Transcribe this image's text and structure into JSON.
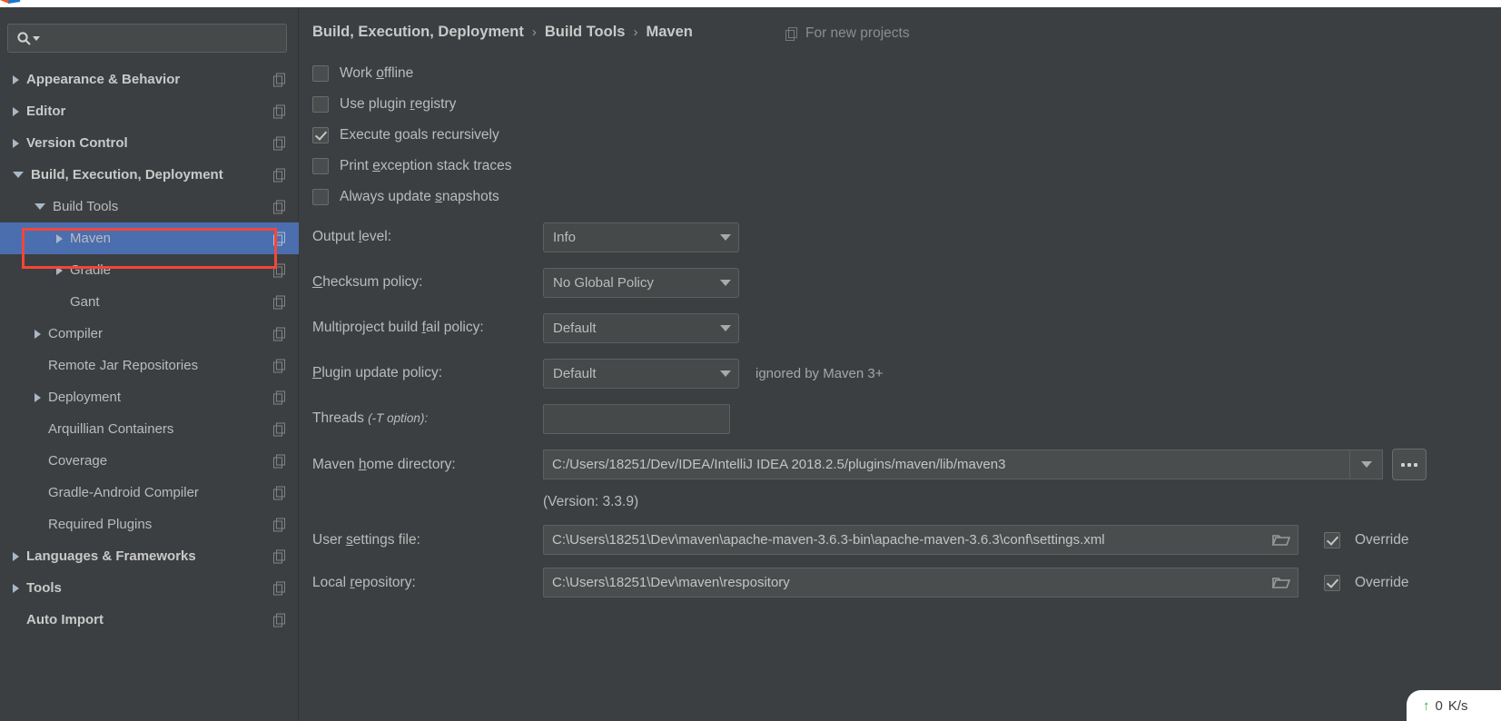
{
  "window": {
    "app_accent": "#4b6eaf",
    "highlight_outline": "#f2463a"
  },
  "sidebar": {
    "search": {
      "placeholder": "",
      "value": "",
      "icon": "search-icon"
    },
    "items": [
      {
        "label": "Appearance & Behavior",
        "indent": 0,
        "arrow": "right",
        "bold": true,
        "selected": false
      },
      {
        "label": "Editor",
        "indent": 0,
        "arrow": "right",
        "bold": true,
        "selected": false
      },
      {
        "label": "Version Control",
        "indent": 0,
        "arrow": "right",
        "bold": true,
        "selected": false
      },
      {
        "label": "Build, Execution, Deployment",
        "indent": 0,
        "arrow": "down",
        "bold": true,
        "selected": false
      },
      {
        "label": "Build Tools",
        "indent": 1,
        "arrow": "down",
        "bold": false,
        "selected": false
      },
      {
        "label": "Maven",
        "indent": 2,
        "arrow": "right",
        "bold": false,
        "selected": true
      },
      {
        "label": "Gradle",
        "indent": 2,
        "arrow": "right",
        "bold": false,
        "selected": false
      },
      {
        "label": "Gant",
        "indent": 2,
        "arrow": "none",
        "bold": false,
        "selected": false
      },
      {
        "label": "Compiler",
        "indent": 1,
        "arrow": "right",
        "bold": false,
        "selected": false
      },
      {
        "label": "Remote Jar Repositories",
        "indent": 1,
        "arrow": "none",
        "bold": false,
        "selected": false
      },
      {
        "label": "Deployment",
        "indent": 1,
        "arrow": "right",
        "bold": false,
        "selected": false
      },
      {
        "label": "Arquillian Containers",
        "indent": 1,
        "arrow": "none",
        "bold": false,
        "selected": false
      },
      {
        "label": "Coverage",
        "indent": 1,
        "arrow": "none",
        "bold": false,
        "selected": false
      },
      {
        "label": "Gradle-Android Compiler",
        "indent": 1,
        "arrow": "none",
        "bold": false,
        "selected": false
      },
      {
        "label": "Required Plugins",
        "indent": 1,
        "arrow": "none",
        "bold": false,
        "selected": false
      },
      {
        "label": "Languages & Frameworks",
        "indent": 0,
        "arrow": "right",
        "bold": true,
        "selected": false
      },
      {
        "label": "Tools",
        "indent": 0,
        "arrow": "right",
        "bold": true,
        "selected": false
      },
      {
        "label": "Auto Import",
        "indent": 0,
        "arrow": "none",
        "bold": true,
        "selected": false
      }
    ]
  },
  "header": {
    "crumb1": "Build, Execution, Deployment",
    "crumb2": "Build Tools",
    "crumb3": "Maven",
    "separator": "›",
    "for_new_projects": "For new projects"
  },
  "checkboxes": [
    {
      "label_pre": "Work ",
      "mnemonic": "o",
      "label_post": "ffline",
      "checked": false,
      "name": "work-offline"
    },
    {
      "label_pre": "Use plugin ",
      "mnemonic": "r",
      "label_post": "egistry",
      "checked": false,
      "name": "use-plugin-registry"
    },
    {
      "label_pre": "Execute ",
      "mnemonic": "g",
      "label_post": "oals recursively",
      "checked": true,
      "name": "execute-goals-recursively"
    },
    {
      "label_pre": "Print ",
      "mnemonic": "e",
      "label_post": "xception stack traces",
      "checked": false,
      "name": "print-exception-stack-traces"
    },
    {
      "label_pre": "Always update ",
      "mnemonic": "s",
      "label_post": "napshots",
      "checked": false,
      "name": "always-update-snapshots"
    }
  ],
  "fields": {
    "output_level": {
      "label_pre": "Output ",
      "mnemonic": "l",
      "label_post": "evel:",
      "value": "Info"
    },
    "checksum_policy": {
      "label_pre": "",
      "mnemonic": "C",
      "label_post": "hecksum policy:",
      "value": "No Global Policy"
    },
    "multiproject_fail": {
      "label_pre": "Multiproject build ",
      "mnemonic": "f",
      "label_post": "ail policy:",
      "value": "Default"
    },
    "plugin_update": {
      "label_pre": "",
      "mnemonic": "P",
      "label_post": "lugin update policy:",
      "value": "Default",
      "note": "ignored by Maven 3+"
    },
    "threads": {
      "label_main": "Threads ",
      "label_italic": "(-T option):",
      "value": ""
    },
    "maven_home": {
      "label_pre": "Maven ",
      "mnemonic": "h",
      "label_post": "ome directory:",
      "value": "C:/Users/18251/Dev/IDEA/IntelliJ IDEA 2018.2.5/plugins/maven/lib/maven3",
      "browse_label": "..."
    },
    "version_note": "(Version: 3.3.9)",
    "user_settings": {
      "label_pre": "User ",
      "mnemonic": "s",
      "label_post": "ettings file:",
      "value": "C:\\Users\\18251\\Dev\\maven\\apache-maven-3.6.3-bin\\apache-maven-3.6.3\\conf\\settings.xml",
      "override_label": "Override",
      "override_checked": true
    },
    "local_repo": {
      "label_pre": "Local ",
      "mnemonic": "r",
      "label_post": "epository:",
      "value": "C:\\Users\\18251\\Dev\\maven\\respository",
      "override_label": "Override",
      "override_checked": true
    }
  },
  "status": {
    "network_speed": "0",
    "network_unit": "K/s",
    "arrow": "↑"
  }
}
